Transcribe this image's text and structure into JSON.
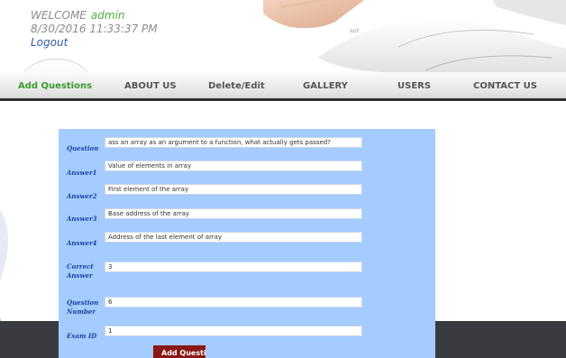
{
  "header": {
    "welcome_label": "WELCOME",
    "username": "admin",
    "datetime": "8/30/2016 11:33:37 PM",
    "logout_label": "Logout"
  },
  "nav": {
    "items": [
      {
        "label": "Add Questions",
        "active": true
      },
      {
        "label": "ABOUT US",
        "active": false
      },
      {
        "label": "Delete/Edit",
        "active": false
      },
      {
        "label": "GALLERY",
        "active": false
      },
      {
        "label": "USERS",
        "active": false
      },
      {
        "label": "CONTACT US",
        "active": false
      }
    ]
  },
  "form": {
    "question_label": "Question",
    "question_value": "ass an array as an argument to a function, what actually gets passed?",
    "answer1_label": "Answer1",
    "answer1_value": "Value of elements in array",
    "answer2_label": "Answer2",
    "answer2_value": "First element of the array",
    "answer3_label": "Answer3",
    "answer3_value": "Base address of the array",
    "answer4_label": "Answer4",
    "answer4_value": "Address of the last element of array",
    "correct_label_line1": "Correct",
    "correct_label_line2": "Answer",
    "correct_value": "3",
    "qnum_label_line1": "Question",
    "qnum_label_line2": "Number",
    "qnum_value": "6",
    "examid_label": "Exam ID",
    "examid_value": "1",
    "submit_label": "Add Questic"
  },
  "colors": {
    "accent_green": "#3a9b2e",
    "panel_blue": "#a4ccfe",
    "label_blue": "#1c3fa0",
    "submit_red": "#8b1717"
  }
}
